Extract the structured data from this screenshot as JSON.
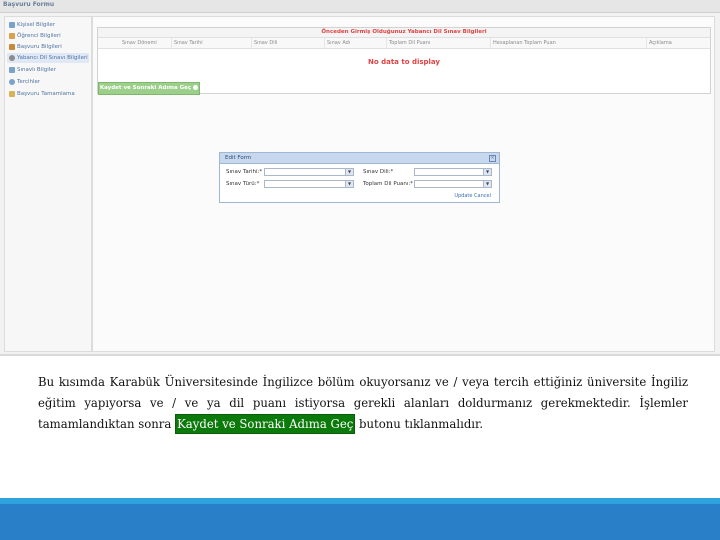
{
  "window": {
    "title": "Başvuru Formu"
  },
  "sidebar": {
    "items": [
      {
        "label": "Kişisel Bilgiler",
        "icon": "person-icon",
        "color": "#7aa3cc"
      },
      {
        "label": "Öğrenci Bilgileri",
        "icon": "student-icon",
        "color": "#d9a24a"
      },
      {
        "label": "Başvuru Bilgileri",
        "icon": "document-icon",
        "color": "#c98a3a"
      },
      {
        "label": "Yabancı Dil Sınavı Bilgileri",
        "icon": "globe-icon",
        "color": "#8c8c8c"
      },
      {
        "label": "Sınavlı Bilgiler",
        "icon": "list-icon",
        "color": "#7aa3cc"
      },
      {
        "label": "Tercihler",
        "icon": "search-icon",
        "color": "#7aa3cc"
      },
      {
        "label": "Başvuru Tamamlama",
        "icon": "folder-icon",
        "color": "#d8b35a"
      }
    ]
  },
  "grid": {
    "title": "Önceden Girmiş Olduğunuz Yabancı Dil Sınav Bilgileri",
    "columns": [
      "Sınav Dönemi",
      "Sınav Tarihi",
      "Sınav Dili",
      "Sınav Adı",
      "Toplam Dil Puanı",
      "Hesaplanan Toplam Puan",
      "Açıklama"
    ],
    "empty_text": "No data to display"
  },
  "save_button": {
    "label": "Kaydet ve Sonraki Adıma Geç"
  },
  "edit_form": {
    "title": "Edit Form",
    "labels": {
      "exam_date": "Sınav Tarihi:*",
      "exam_type": "Sınav Türü:*",
      "exam_lang": "Sınav Dili:*",
      "total_score": "Toplam Dil Puanı:*"
    },
    "update_label": "Update",
    "cancel_label": "Cancel"
  },
  "description": {
    "text": "Bu kısımda Karabük Üniversitesinde İngilizce bölüm okuyorsanız ve / veya tercih ettiğiniz üniversite İngiliz eğitim yapıyorsa ve / ve ya dil puanı istiyorsa gerekli alanları doldurmanız gerekmektedir. İşlemler tamamlandıktan sonra",
    "highlight": "Kaydet ve Sonraki Adıma Geç",
    "suffix": "butonu tıklanmalıdır."
  },
  "colors": {
    "highlight_bg": "#0b7a0b",
    "accent": "#2a7fc9",
    "error_text": "#e04444"
  }
}
